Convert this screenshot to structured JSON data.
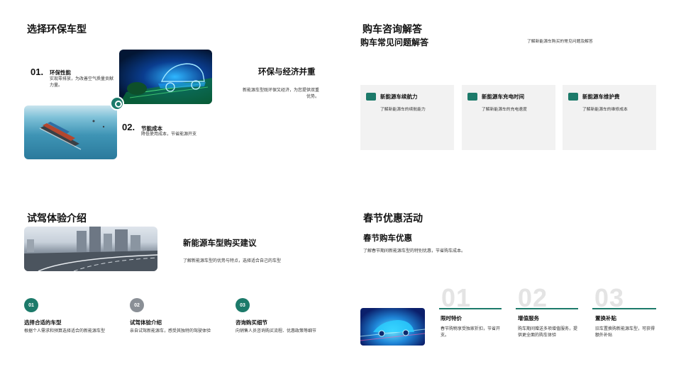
{
  "slide1": {
    "title": "选择环保车型",
    "item1": {
      "num": "01.",
      "title": "环保性能",
      "desc": "实现零排放，为改善空气质量贡献力量。"
    },
    "item2": {
      "num": "02.",
      "title": "节能成本",
      "desc": "降低使用成本，节省能源开支"
    },
    "right_heading": "环保与经济并重",
    "right_desc": "新能源车型既环保又经济，为您提供双重优势。"
  },
  "slide2": {
    "title": "购车咨询解答",
    "subtitle": "购车常见问题解答",
    "subdesc": "了解新能源车购买的常见问题及解答",
    "cards": [
      {
        "icon": "briefcase-icon",
        "title": "新能源车续航力",
        "desc": "了解新能源车的续航能力"
      },
      {
        "icon": "sofa-icon",
        "title": "新能源车充电时间",
        "desc": "了解新能源车的充电速度"
      },
      {
        "icon": "chat-icon",
        "title": "新能源车维护费",
        "desc": "了解新能源车的维修成本"
      }
    ]
  },
  "slide3": {
    "title": "试驾体验介绍",
    "heading": "新能源车型购买建议",
    "desc": "了解新能源车型的优势与特点，选择适合自己的车型",
    "steps": [
      {
        "num": "01",
        "title": "选择合适的车型",
        "desc": "根据个人需求和预算选择适合的新能源车型",
        "color": "#1c7a6a"
      },
      {
        "num": "02",
        "title": "试驾体验介绍",
        "desc": "亲自试驾新能源车，感受其独特的驾驶体验",
        "color": "#8a8f96"
      },
      {
        "num": "03",
        "title": "咨询购买细节",
        "desc": "向销售人员咨询购买流程、优惠政策等细节",
        "color": "#1c7a6a"
      }
    ]
  },
  "slide4": {
    "title": "春节优惠活动",
    "heading": "春节购车优惠",
    "desc": "了解春节期间新能源车型的特别优惠，节省购车成本。",
    "offers": [
      {
        "num": "01",
        "title": "限时特价",
        "desc": "春节购物享受独家折扣，节省开支。"
      },
      {
        "num": "02",
        "title": "增值服务",
        "desc": "购车期间赠送多项增值服务，提供更全面的购车体验"
      },
      {
        "num": "03",
        "title": "置换补贴",
        "desc": "旧车置换购新能源车型，可获得额外补贴"
      }
    ],
    "accent": "#1c7a6a"
  }
}
